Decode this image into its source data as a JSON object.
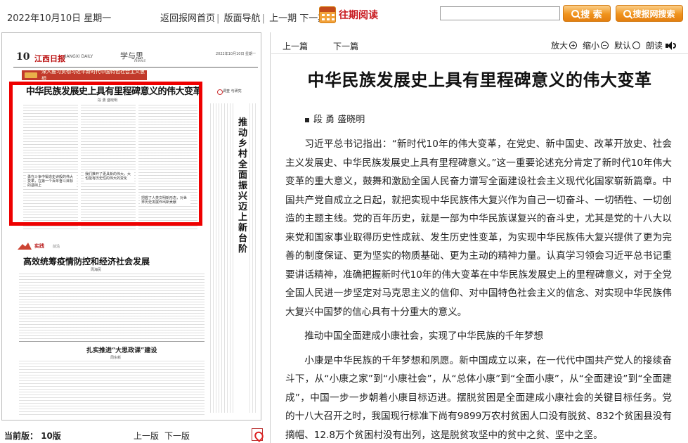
{
  "header": {
    "date": "2022年10月10日 星期一",
    "nav": [
      "返回报网首页",
      "版面导航",
      "上一期",
      "下一期"
    ],
    "archive_label": "往期阅读",
    "search_placeholder": "",
    "search_button": "搜 索",
    "site_search_button": "搜报网搜索"
  },
  "newspaper": {
    "page_number": "10",
    "masthead_name": "江西日报",
    "masthead_en": "JIANGXI DAILY",
    "section": "学与思",
    "section_en": "News",
    "masthead_date": "2022年10月10日 星期一",
    "banner": "深入推习贯彻习近平新时代中国特色社会主义思想",
    "main_title": "中华民族发展史上具有里程碑意义的伟大变革",
    "byline": "段 勇  盛晓明",
    "pullquote_1": "勇在斗争中锻造史诗般的伟大变革，在第一个百年奋斗目标的基础上",
    "pullquote_2": "我们推开了更具新的伟大，大也能有历史性的伟大的变化",
    "pullquote_3": "把握了人类文明新形态，对世界历史发展作出新贡献",
    "sidebar_label": "调查 与研究",
    "sidebar_title": "推动乡村全面振兴迈上新台阶",
    "practice_label": "实践",
    "practice_en": "前沿",
    "article2_title": "高效统筹疫情防控和经济社会发展",
    "byline2": "周海民",
    "article3_title": "扎实推进“大思政课”建设",
    "byline3": "周东新"
  },
  "left_footer": {
    "current_label": "当前版：",
    "current_value": "10版",
    "prev": "上一版",
    "next": "下一版"
  },
  "article_nav": {
    "prev": "上一篇",
    "next": "下一篇"
  },
  "tools": {
    "zoom_in": "放大",
    "zoom_out": "缩小",
    "default": "默认",
    "read_aloud": "朗读"
  },
  "article": {
    "title": "中华民族发展史上具有里程碑意义的伟大变革",
    "authors": "段 勇  盛晓明",
    "paragraphs": [
      "习近平总书记指出：“新时代10年的伟大变革，在党史、新中国史、改革开放史、社会主义发展史、中华民族发展史上具有里程碑意义。”这一重要论述充分肯定了新时代10年伟大变革的重大意义，鼓舞和激励全国人民奋力谱写全面建设社会主义现代化国家崭新篇章。中国共产党自成立之日起，就把实现中华民族伟大复兴作为自己一切奋斗、一切牺牲、一切创造的主题主线。党的百年历史，就是一部为中华民族谋复兴的奋斗史，尤其是党的十八大以来党和国家事业取得历史性成就、发生历史性变革，为实现中华民族伟大复兴提供了更为完善的制度保证、更为坚实的物质基础、更为主动的精神力量。认真学习领会习近平总书记重要讲话精神，准确把握新时代10年的伟大变革在中华民族发展史上的里程碑意义，对于全党全国人民进一步坚定对马克思主义的信仰、对中国特色社会主义的信念、对实现中华民族伟大复兴中国梦的信心具有十分重大的意义。",
      "推动中国全面建成小康社会，实现了中华民族的千年梦想",
      "小康是中华民族的千年梦想和夙愿。新中国成立以来，在一代代中国共产党人的接续奋斗下，从“小康之家”到“小康社会”，从“总体小康”到“全面小康”，从“全面建设”到“全面建成”，中国一步一步朝着小康目标迈进。摆脱贫困是全面建成小康社会的关键目标任务。党的十八大召开之时，我国现行标准下尚有9899万农村贫困人口没有脱贫、832个贫困县没有摘帽、12.8万个贫困村没有出列，这是脱贫攻坚中的贫中之贫、坚中之坚。"
    ]
  }
}
